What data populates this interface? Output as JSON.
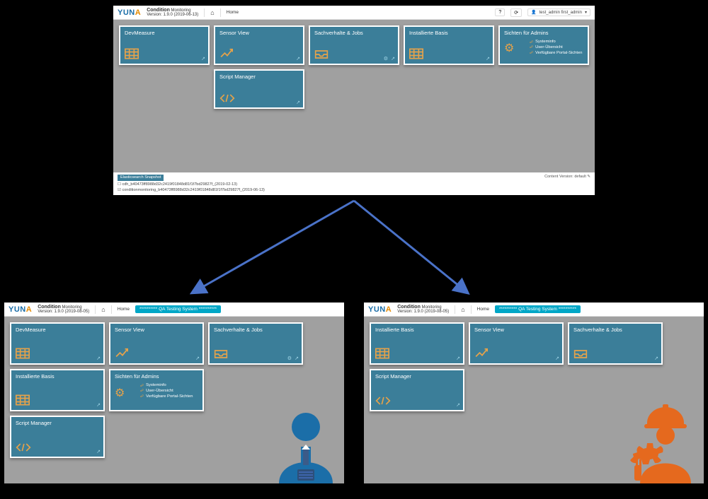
{
  "app": {
    "logo_part1": "YUN",
    "logo_part2": "A",
    "title_strong": "Condition",
    "title_light": "Monitoring",
    "version_top": "Version: 1.9.0 (2019-06-13)",
    "version_bottom": "Version: 1.9.0 (2019-08-05)",
    "home_label": "Home",
    "qa_badge": "********** QA Testing System **********",
    "account_label": "test_admin first_admin",
    "account_caret": "▾"
  },
  "tiles": {
    "devmeasure": "DevMeasure",
    "sensorview": "Sensor View",
    "sachverhalte": "Sachverhalte & Jobs",
    "installierte": "Installierte Basis",
    "sichten": "Sichten für Admins",
    "scriptmanager": "Script Manager",
    "sichten_items": {
      "a": "Systeminfo",
      "b": "User-Übersicht",
      "c": "Verfügbare Portal-Sichten"
    },
    "popout": "↗",
    "cog": "⚙"
  },
  "footer": {
    "badge": "Elasticsearch Snapshot",
    "line1": "☐ cdh_b40473ff8988d32c2419f01848d81f1f7bd29827f_(2019-02-13)",
    "line2": "☑ conditionmonitoring_b40473ff8988d32c2419f01848d81f1f7bd29827f_(2019-06-13)",
    "content_version": "Content Version: default ✎"
  }
}
